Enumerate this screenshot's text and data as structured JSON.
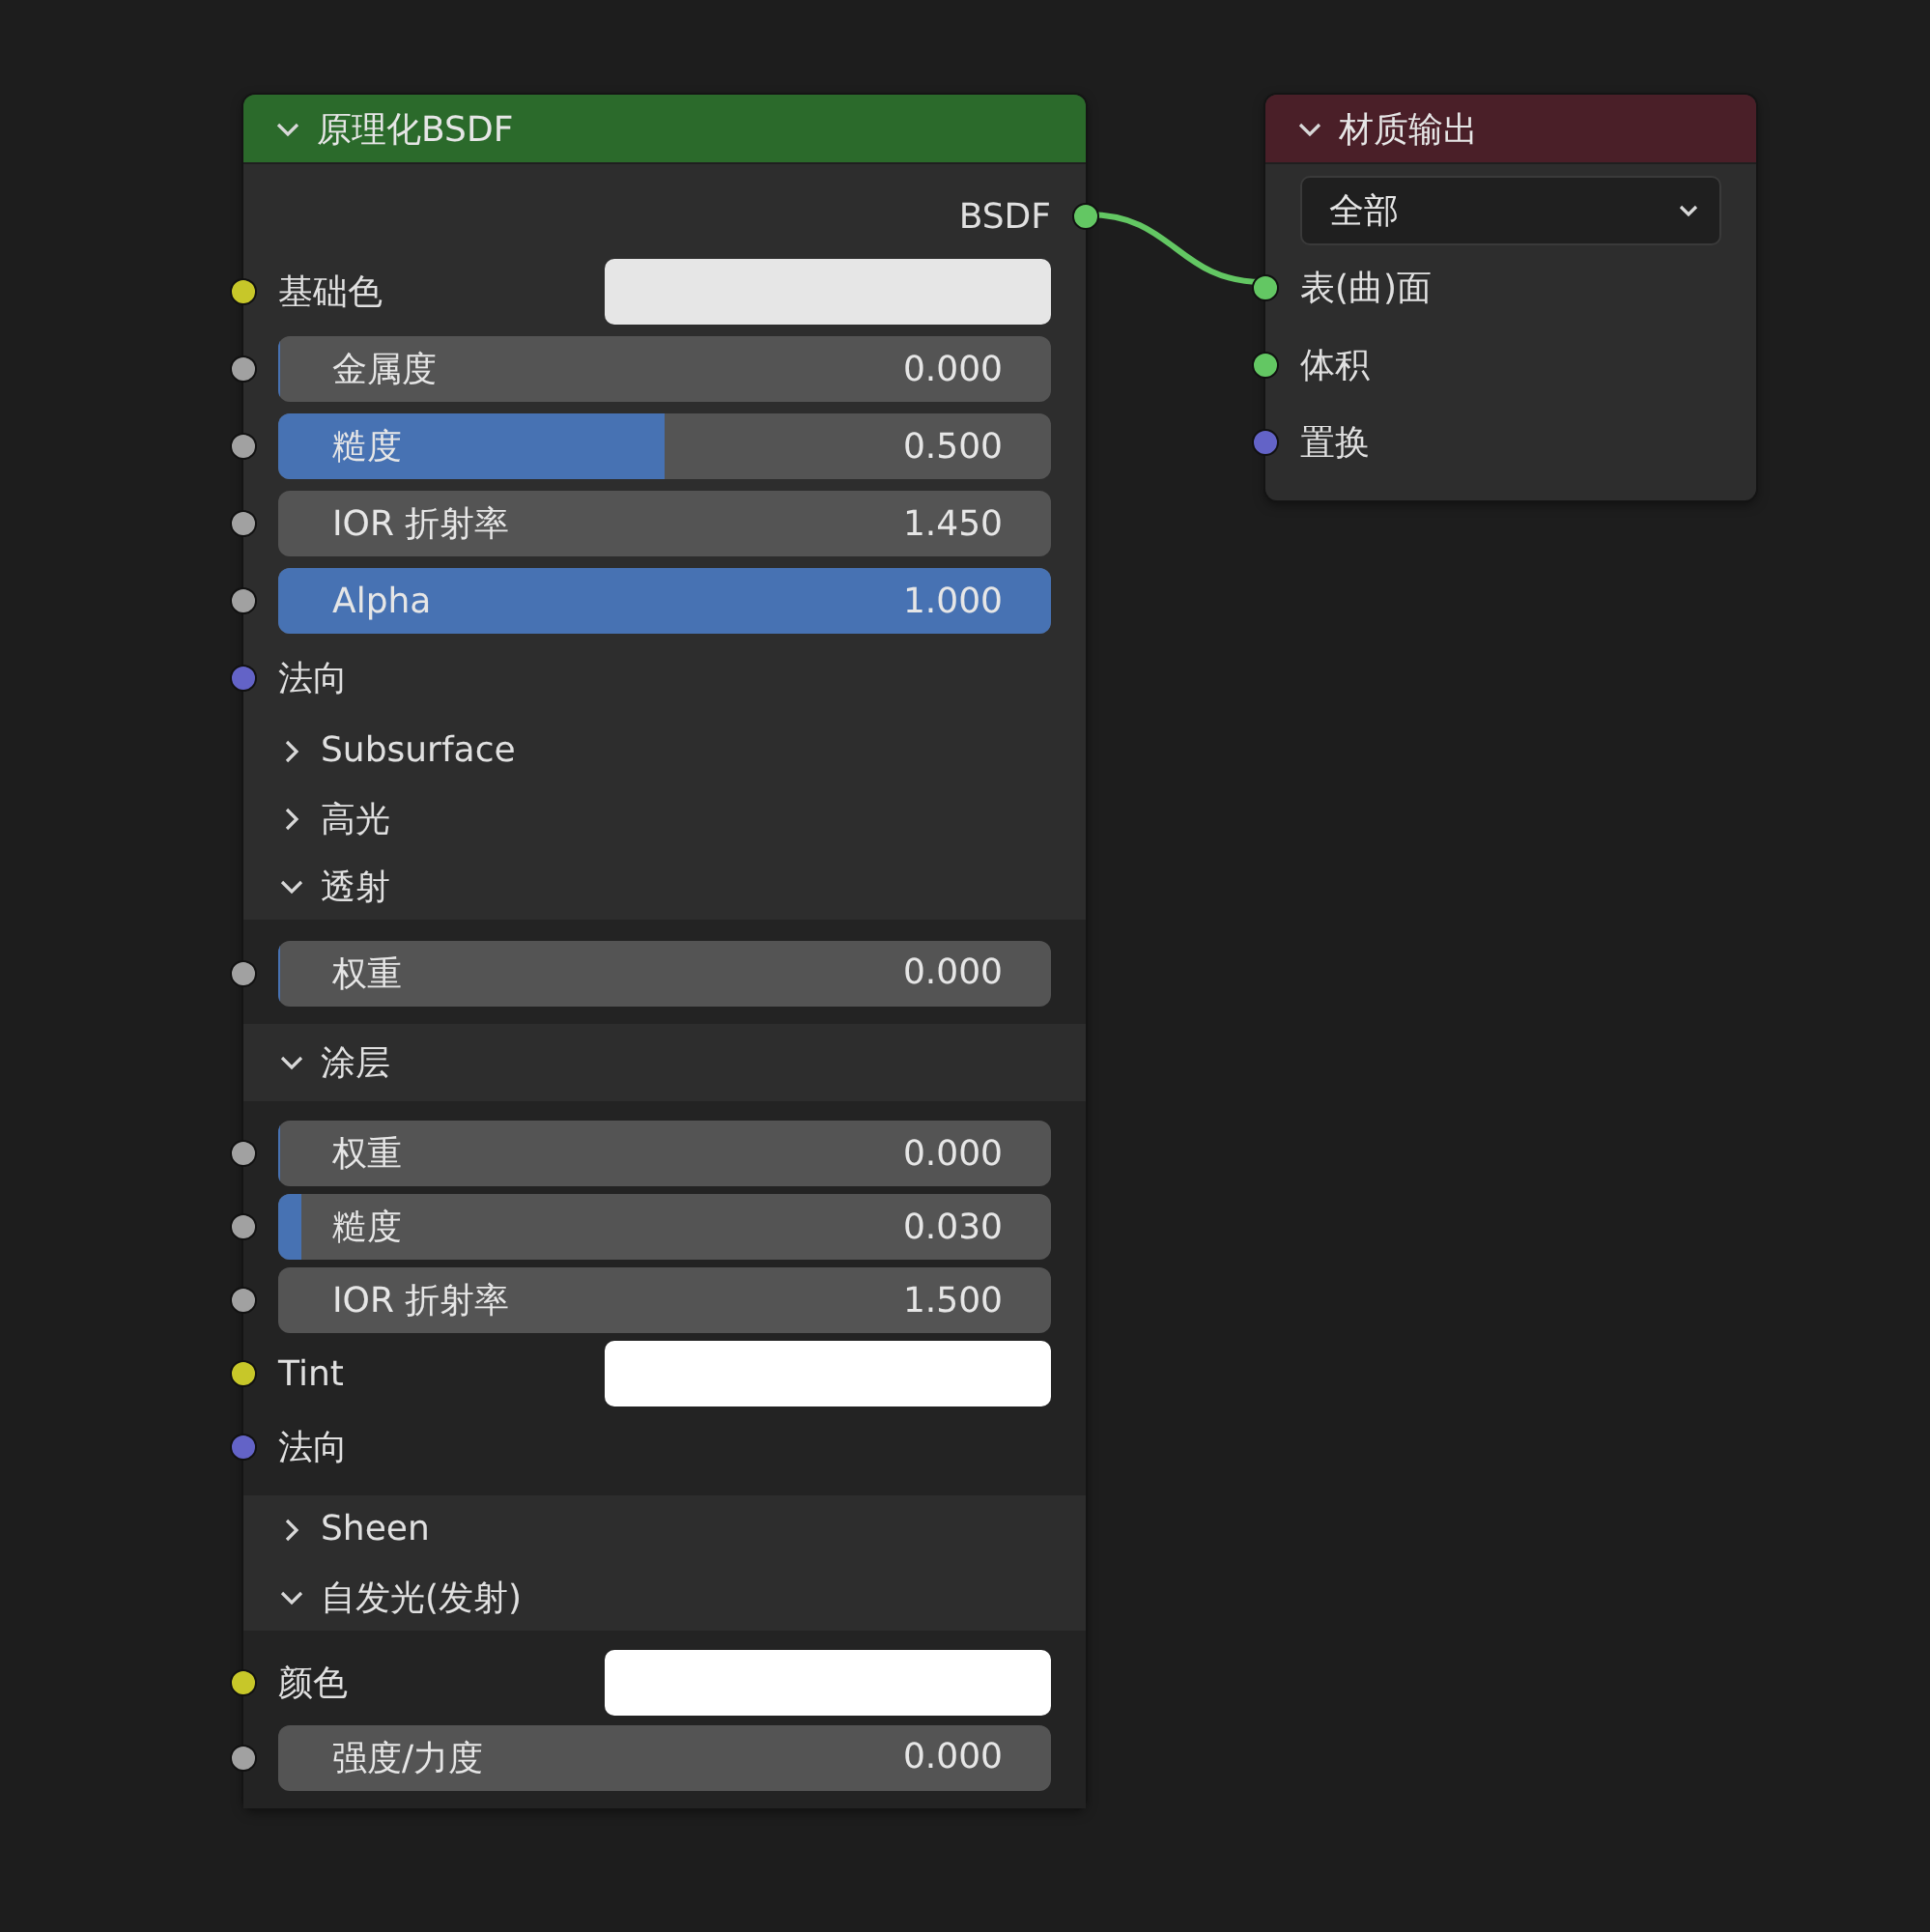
{
  "nodes": [
    {
      "title": "原理化BSDF",
      "color": "#2b6a2b",
      "expanded": true,
      "rows": [
        {
          "kind": "output",
          "label": "BSDF",
          "color": "#63c763"
        },
        {
          "kind": "color",
          "label": "基础色",
          "color": "#c7c729",
          "swatch": {
            "color": "#e6e6e6"
          }
        },
        {
          "kind": "slider",
          "label": "金属度",
          "value": "0.000",
          "level": 0,
          "color": "#a1a1a1"
        },
        {
          "kind": "slider",
          "label": "糙度",
          "value": "0.500",
          "level": 0.5,
          "color": "#a1a1a1"
        },
        {
          "kind": "number",
          "label": "IOR 折射率",
          "value": "1.450",
          "color": "#a1a1a1"
        },
        {
          "kind": "slider",
          "label": "Alpha",
          "value": "1.000",
          "level": 1,
          "color": "#a1a1a1"
        },
        {
          "kind": "socket",
          "label": "法向",
          "color": "#6363c7"
        },
        {
          "kind": "panel",
          "label": "Subsurface",
          "expanded": false
        },
        {
          "kind": "panel",
          "label": "高光",
          "expanded": false
        },
        {
          "kind": "panel",
          "label": "透射",
          "expanded": true,
          "children": [
            {
              "kind": "slider",
              "label": "权重",
              "value": "0.000",
              "level": 0,
              "color": "#a1a1a1"
            }
          ]
        },
        {
          "kind": "panel",
          "label": "涂层",
          "expanded": true,
          "children": [
            {
              "kind": "slider",
              "label": "权重",
              "value": "0.000",
              "level": 0,
              "color": "#a1a1a1"
            },
            {
              "kind": "slider",
              "label": "糙度",
              "value": "0.030",
              "level": 0.03,
              "color": "#a1a1a1"
            },
            {
              "kind": "number",
              "label": "IOR 折射率",
              "value": "1.500",
              "color": "#a1a1a1"
            },
            {
              "kind": "color",
              "label": "Tint",
              "color": "#c7c729",
              "swatch": {
                "color": "#ffffff"
              }
            },
            {
              "kind": "socket",
              "label": "法向",
              "color": "#6363c7"
            }
          ]
        },
        {
          "kind": "panel",
          "label": "Sheen",
          "expanded": false
        },
        {
          "kind": "panel",
          "label": "自发光(发射)",
          "expanded": true,
          "children": [
            {
              "kind": "color",
              "label": "颜色",
              "color": "#c7c729",
              "swatch": {
                "color": "#ffffff"
              }
            },
            {
              "kind": "number",
              "label": "强度/力度",
              "value": "0.000",
              "color": "#a1a1a1"
            }
          ]
        }
      ]
    },
    {
      "title": "材质输出",
      "color": "#4a1f28",
      "expanded": true,
      "rows": [
        {
          "kind": "dropdown",
          "value": "全部"
        },
        {
          "kind": "socket",
          "label": "表(曲)面",
          "color": "#63c763"
        },
        {
          "kind": "socket",
          "label": "体积",
          "color": "#63c763"
        },
        {
          "kind": "socket",
          "label": "置换",
          "color": "#6363c7"
        }
      ]
    }
  ]
}
